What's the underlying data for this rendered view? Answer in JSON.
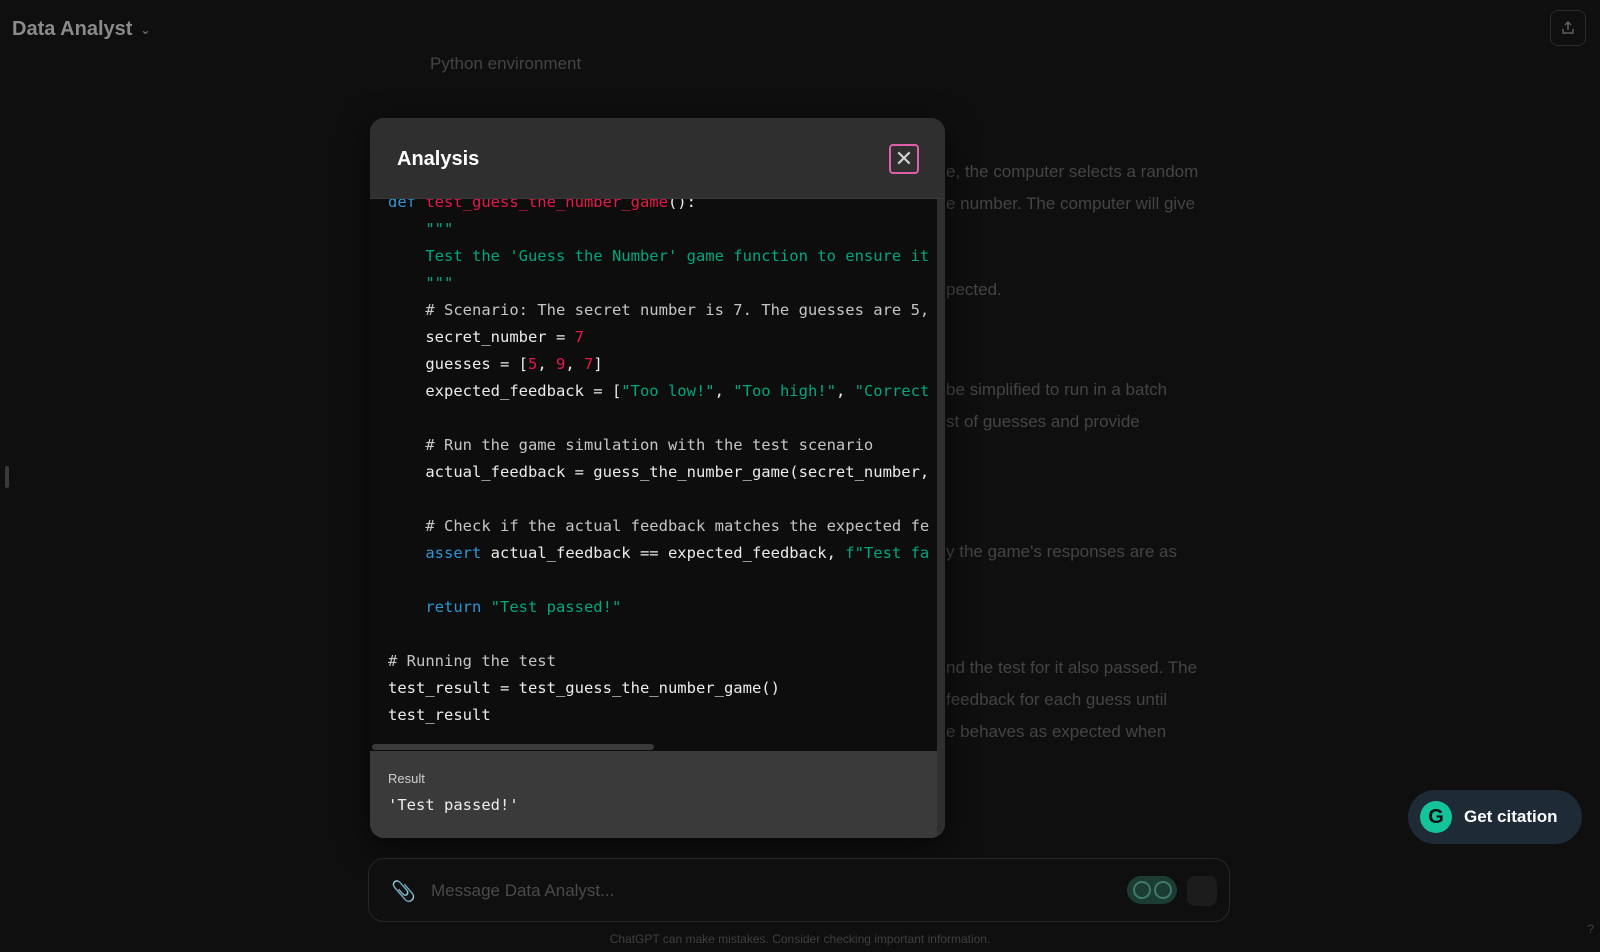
{
  "app": {
    "title": "Data Analyst"
  },
  "background": {
    "env_label": "Python environment",
    "fragments": [
      "e, the computer selects a random",
      "e number. The computer will give",
      "pected.",
      " be simplified to run in a batch",
      "st of guesses and provide",
      "y the game's responses are as",
      "nd the test for it also passed. The",
      " feedback for each guess until",
      "e behaves as expected when"
    ]
  },
  "modal": {
    "title": "Analysis",
    "result_label": "Result",
    "result_value": "'Test passed!'"
  },
  "code_lines": [
    {
      "indent": 0,
      "tokens": [
        [
          "kw",
          "def "
        ],
        [
          "fn",
          "test_guess_the_number_game"
        ],
        [
          "plain",
          "():"
        ]
      ]
    },
    {
      "indent": 1,
      "tokens": [
        [
          "str",
          "\"\"\""
        ]
      ]
    },
    {
      "indent": 1,
      "tokens": [
        [
          "str",
          "Test the 'Guess the Number' game function to ensure it"
        ]
      ]
    },
    {
      "indent": 1,
      "tokens": [
        [
          "str",
          "\"\"\""
        ]
      ]
    },
    {
      "indent": 1,
      "tokens": [
        [
          "cm",
          "# Scenario: The secret number is 7. The guesses are 5,"
        ]
      ]
    },
    {
      "indent": 1,
      "tokens": [
        [
          "plain",
          "secret_number = "
        ],
        [
          "num",
          "7"
        ]
      ]
    },
    {
      "indent": 1,
      "tokens": [
        [
          "plain",
          "guesses = ["
        ],
        [
          "num",
          "5"
        ],
        [
          "plain",
          ", "
        ],
        [
          "num",
          "9"
        ],
        [
          "plain",
          ", "
        ],
        [
          "num",
          "7"
        ],
        [
          "plain",
          "]"
        ]
      ]
    },
    {
      "indent": 1,
      "tokens": [
        [
          "plain",
          "expected_feedback = ["
        ],
        [
          "str",
          "\"Too low!\""
        ],
        [
          "plain",
          ", "
        ],
        [
          "str",
          "\"Too high!\""
        ],
        [
          "plain",
          ", "
        ],
        [
          "str",
          "\"Correct"
        ]
      ]
    },
    {
      "indent": 0,
      "tokens": []
    },
    {
      "indent": 1,
      "tokens": [
        [
          "cm",
          "# Run the game simulation with the test scenario"
        ]
      ]
    },
    {
      "indent": 1,
      "tokens": [
        [
          "plain",
          "actual_feedback = guess_the_number_game(secret_number,"
        ]
      ]
    },
    {
      "indent": 0,
      "tokens": []
    },
    {
      "indent": 1,
      "tokens": [
        [
          "cm",
          "# Check if the actual feedback matches the expected fe"
        ]
      ]
    },
    {
      "indent": 1,
      "tokens": [
        [
          "kw",
          "assert"
        ],
        [
          "plain",
          " actual_feedback == expected_feedback, "
        ],
        [
          "str",
          "f\"Test fa"
        ]
      ]
    },
    {
      "indent": 0,
      "tokens": []
    },
    {
      "indent": 1,
      "tokens": [
        [
          "kw",
          "return "
        ],
        [
          "str",
          "\"Test passed!\""
        ]
      ]
    },
    {
      "indent": 0,
      "tokens": []
    },
    {
      "indent": 0,
      "tokens": [
        [
          "cm",
          "# Running the test"
        ]
      ]
    },
    {
      "indent": 0,
      "tokens": [
        [
          "plain",
          "test_result = test_guess_the_number_game()"
        ]
      ]
    },
    {
      "indent": 0,
      "tokens": [
        [
          "plain",
          "test_result"
        ]
      ]
    }
  ],
  "composer": {
    "placeholder": "Message Data Analyst..."
  },
  "citation": {
    "label": "Get citation",
    "icon": "G"
  },
  "footer": {
    "disclaimer": "ChatGPT can make mistakes. Consider checking important information.",
    "help": "?"
  },
  "icons": {
    "close": "close-icon",
    "clip": "paperclip-icon",
    "share": "share-icon",
    "chevron": "chevron-down-icon"
  }
}
